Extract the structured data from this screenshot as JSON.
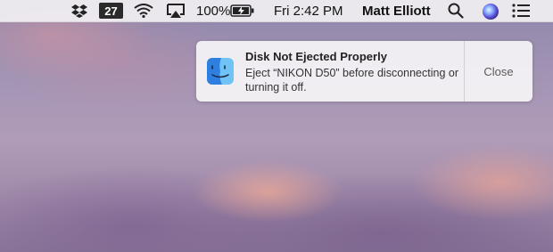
{
  "menubar": {
    "calendar_day": "27",
    "battery_percent": "100%",
    "clock": "Fri 2:42 PM",
    "user_name": "Matt Elliott",
    "icons": [
      "dropbox-icon",
      "calendar-icon",
      "wifi-icon",
      "airplay-icon",
      "battery-icon",
      "spotlight-search-icon",
      "siri-icon",
      "notification-center-icon"
    ]
  },
  "notification": {
    "app_icon": "finder-icon",
    "title": "Disk Not Ejected Properly",
    "body": "Eject “NIKON D50” before disconnecting or turning it off.",
    "close_label": "Close"
  }
}
